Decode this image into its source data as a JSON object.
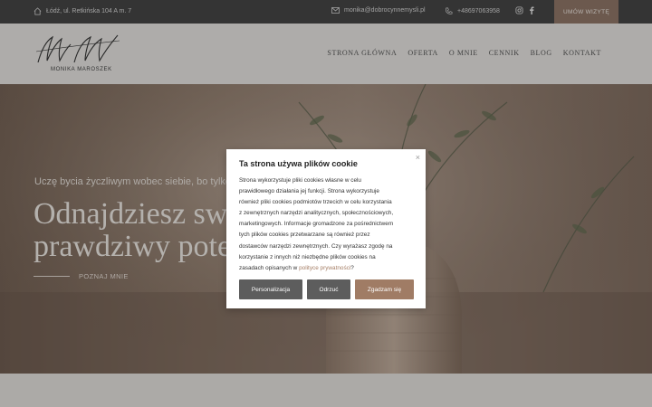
{
  "topbar": {
    "address": "Łódź, ul. Retkińska 104 A m. 7",
    "email": "monika@dobrocynnemysli.pl",
    "phone": "+48697063958",
    "cta_label": "UMÓW WIZYTĘ",
    "icons": [
      "home-icon",
      "mail-icon",
      "phone-icon",
      "instagram-icon",
      "facebook-icon"
    ]
  },
  "header": {
    "logo_text": "MONIKA MAROSZEK",
    "nav": [
      "STRONA GŁÓWNA",
      "OFERTA",
      "O MNIE",
      "CENNIK",
      "BLOG",
      "KONTAKT"
    ]
  },
  "hero": {
    "tagline": "Uczę bycia życzliwym wobec siebie, bo tylko w",
    "headline_line1": "Odnajdziesz swó",
    "headline_line2": "prawdziwy pote",
    "more_label": "POZNAJ MNIE"
  },
  "cookie": {
    "title": "Ta strona używa plików cookie",
    "close": "×",
    "lines": [
      "Strona wykorzystuje pliki cookies własne w celu",
      "prawidłowego działania jej funkcji. Strona wykorzystuje",
      "również pliki cookies podmiotów trzecich w celu korzystania",
      "z zewnętrznych narzędzi analitycznych, społecznościowych,",
      "marketingowych. Informacje gromadzone za pośrednictwem",
      "tych plików cookies przetwarzane są również przez",
      "dostawców narzędzi zewnętrznych. Czy wyrażasz zgodę na",
      "korzystanie z innych niż niezbędne plików cookies na",
      "zasadach opisanych w"
    ],
    "policy_link": "polityce prywatności",
    "policy_suffix": "?",
    "buttons": {
      "personalize": "Personalizacja",
      "deny": "Odrzuć",
      "accept": "Zgadzam się"
    }
  },
  "colors": {
    "topbar_bg": "#3a3a3a",
    "cta_bg": "#8a6f5f",
    "accept_bg": "#a07c65",
    "secondary_btn_bg": "#5d5d5d"
  }
}
